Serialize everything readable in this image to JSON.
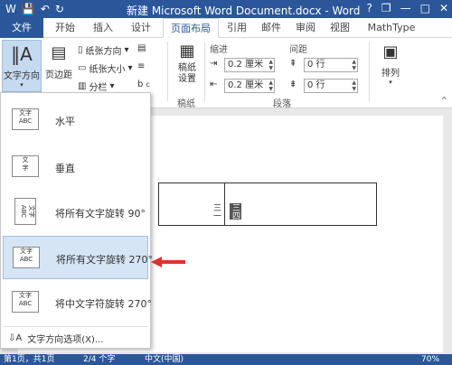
{
  "titlebar": {
    "title": "新建 Microsoft Word Document.docx - Word",
    "save_icon": "save-icon",
    "undo_icon": "undo-icon",
    "redo_icon": "redo-icon",
    "help": "?",
    "restore": "❐",
    "minimize": "—",
    "maximize": "□",
    "close": "✕"
  },
  "tabs": [
    "文件",
    "开始",
    "插入",
    "设计",
    "页面布局",
    "引用",
    "邮件",
    "审阅",
    "视图",
    "MathType"
  ],
  "ribbon": {
    "text_direction": "文字方向",
    "margins": "页边距",
    "orientation": "纸张方向",
    "size": "纸张大小",
    "columns": "分栏",
    "manuscript": "稿纸\n设置",
    "manuscript_group": "稿纸",
    "indent_label": "缩进",
    "spacing_label": "间距",
    "indent_left": "0.2 厘米",
    "indent_right": "0.2 厘米",
    "spacing_before": "0 行",
    "spacing_after": "0 行",
    "paragraph_group": "段落",
    "arrange": "排列"
  },
  "dropdown": {
    "options": [
      {
        "label": "水平",
        "icon_text": "文字\nABC"
      },
      {
        "label": "垂直",
        "icon_text": "文\n字"
      },
      {
        "label": "将所有文字旋转 90°",
        "icon_text": "文字\nABC"
      },
      {
        "label": "将所有文字旋转 270°",
        "icon_text": "文字\nABC"
      },
      {
        "label": "将中文字符旋转 270°",
        "icon_text": "文字\nABC"
      }
    ],
    "more_options": "文字方向选项(X)..."
  },
  "document": {
    "cell_text_1": "三一",
    "cell_text_2": "三四"
  },
  "status": {
    "page": "第1页，共1页",
    "words": "2/4 个字",
    "language": "中文(中国)",
    "zoom": "70%"
  },
  "colors": {
    "accent": "#2b579a",
    "selected": "#d5e5f5",
    "arrow": "#e03030"
  }
}
